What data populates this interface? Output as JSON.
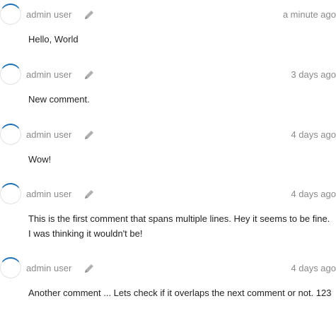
{
  "comments": [
    {
      "author": "admin user",
      "time": "a minute ago",
      "text": "Hello, World",
      "icon": "pencil-icon"
    },
    {
      "author": "admin user",
      "time": "3 days ago",
      "text": "New comment.",
      "icon": "pencil-icon"
    },
    {
      "author": "admin user",
      "time": "4 days ago",
      "text": "Wow!",
      "icon": "pencil-icon"
    },
    {
      "author": "admin user",
      "time": "4 days ago",
      "text": "This is the first comment that spans multiple lines. Hey it seems to be fine. I was thinking it wouldn't be!",
      "icon": "pencil-icon"
    },
    {
      "author": "admin user",
      "time": "4 days ago",
      "text": "Another comment ... Lets check if it overlaps the next comment or not. 123",
      "icon": "pencil-icon"
    }
  ],
  "colors": {
    "avatar_accent": "#1d6fb5",
    "meta_text": "#8a8a8a",
    "body_text": "#222222"
  }
}
